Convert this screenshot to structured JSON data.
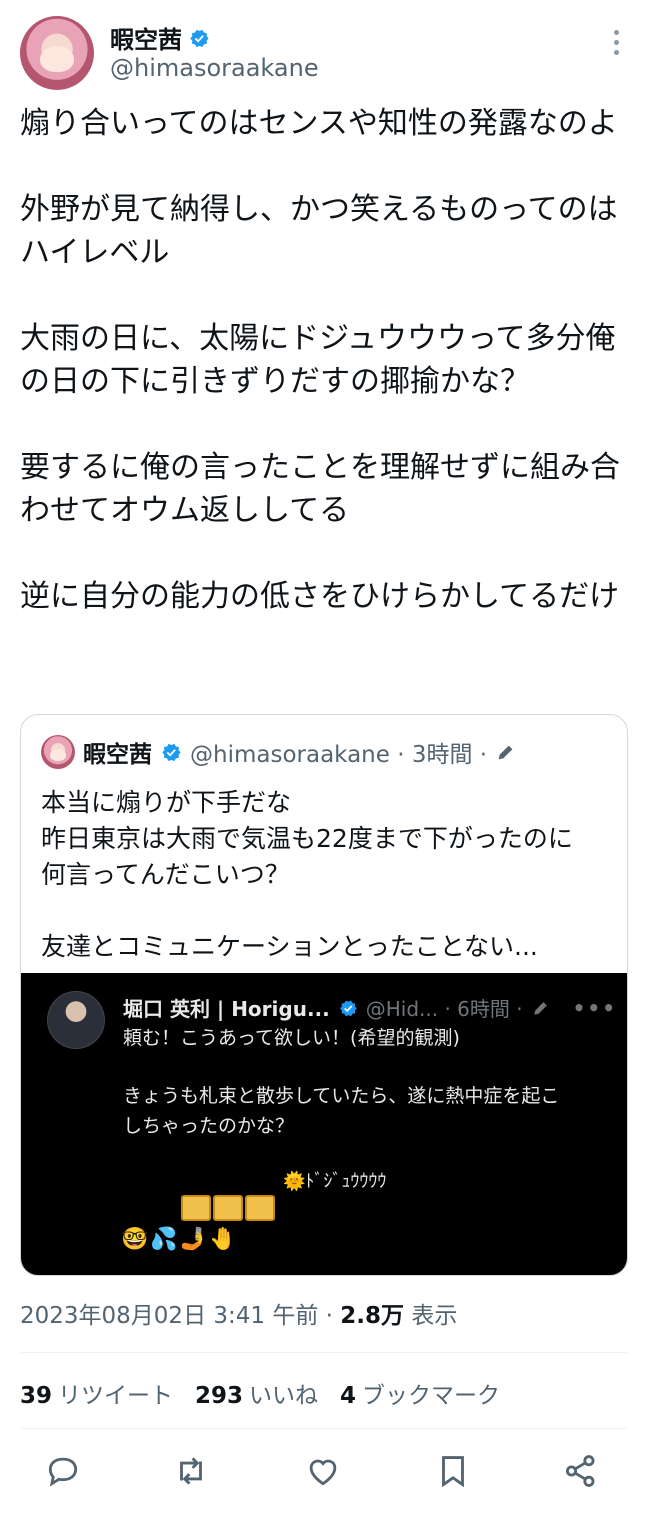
{
  "author": {
    "name": "暇空茜",
    "handle": "@himasoraakane"
  },
  "tweet": {
    "paragraphs": [
      "煽り合いってのはセンスや知性の発露なのよ",
      "外野が見て納得し、かつ笑えるものってのはハイレベル",
      "大雨の日に、太陽にドジュウウウって多分俺の日の下に引きずりだすの揶揄かな？",
      "要するに俺の言ったことを理解せずに組み合わせてオウム返ししてる",
      "逆に自分の能力の低さをひけらかしてるだけ"
    ]
  },
  "quote": {
    "name": "暇空茜",
    "meta": "@himasoraakane · 3時間 ·",
    "lines": [
      "本当に煽りが下手だな",
      "昨日東京は大雨で気温も22度まで下がったのに",
      "何言ってんだこいつ？",
      "",
      "友達とコミュニケーションとったことない..."
    ],
    "embedded": {
      "name": "堀口 英利 | Horigu...",
      "meta": "@Hid... · 6時間 ·",
      "more": "•••",
      "line1": "頼む！こうあって欲しい！(希望的観測)",
      "line2": "きょうも札束と散歩していたら、遂に熱中症を起こ",
      "line3": "しちゃったのかな？",
      "sun_text": "🌞ﾄﾞｼﾞｭｳｳｳｳ",
      "emojis": "🤓💦🤳🤚"
    }
  },
  "timestamp": {
    "time": "2023年08月02日 3:41 午前 · ",
    "views": "2.8万",
    "views_label": " 表示"
  },
  "stats": {
    "retweets": "39",
    "retweets_label": "リツイート",
    "likes": "293",
    "likes_label": "いいね",
    "bookmarks": "4",
    "bookmarks_label": "ブックマーク"
  },
  "colors": {
    "accent": "#1d9bf0",
    "text": "#0f1419",
    "secondary": "#536471",
    "embed_bg": "#000000"
  },
  "icons": [
    "verified-badge-icon",
    "more-icon",
    "pen-icon",
    "reply-icon",
    "retweet-icon",
    "like-icon",
    "bookmark-icon",
    "share-icon"
  ]
}
